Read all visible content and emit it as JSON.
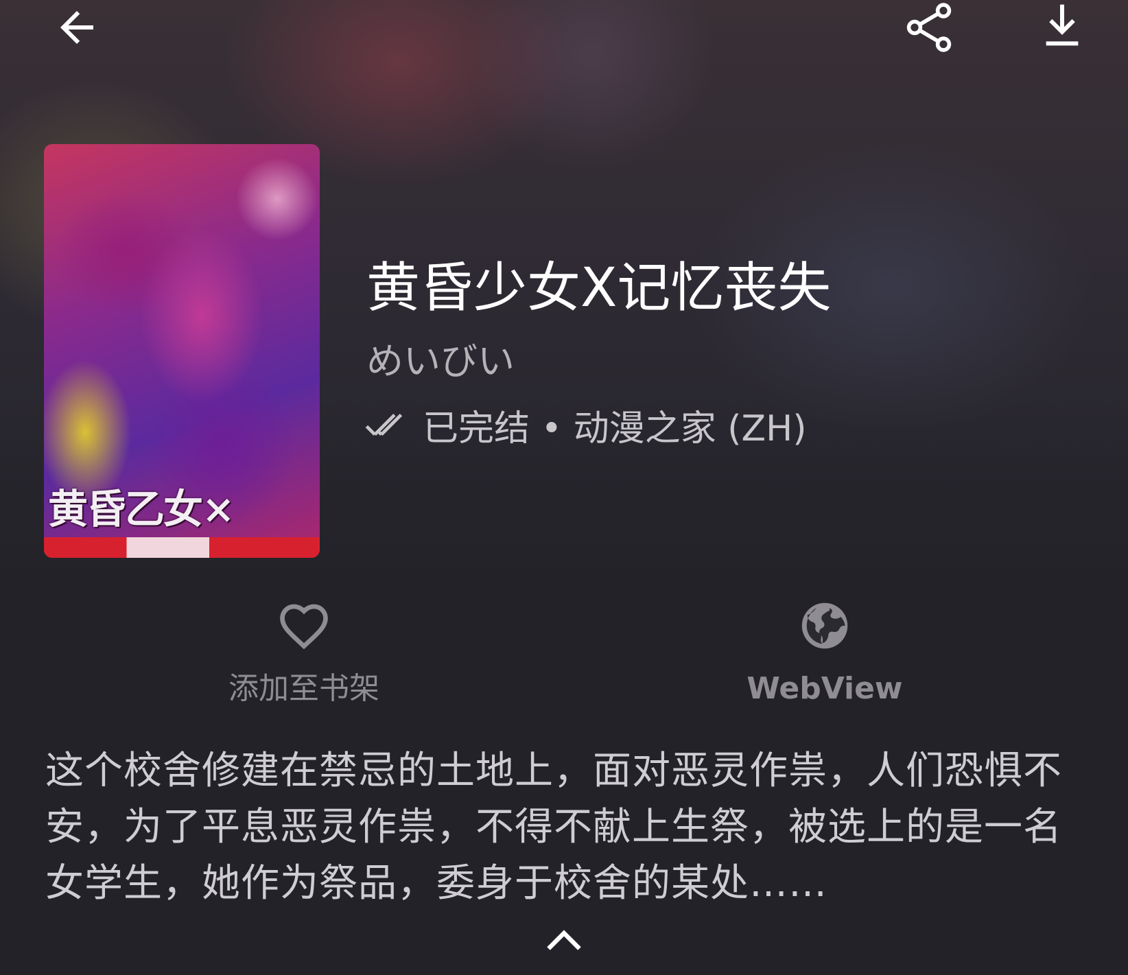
{
  "colors": {
    "background": "#222228",
    "title": "#ffffff",
    "secondary_text": "#b5b3b8",
    "action_grey": "#8f8d93",
    "description_text": "#cfcdd2"
  },
  "topbar": {
    "back_icon": "arrow-back-icon",
    "share_icon": "share-icon",
    "download_icon": "download-icon"
  },
  "cover": {
    "art_title": "黄昏乙女×"
  },
  "manga": {
    "title": "黄昏少女X记忆丧失",
    "author": "めいびい",
    "status_icon": "done-all-icon",
    "status_text": "已完结 • 动漫之家 (ZH)"
  },
  "actions": {
    "favorite": {
      "icon": "heart-outline-icon",
      "label": "添加至书架"
    },
    "webview": {
      "icon": "globe-icon",
      "label": "WebView"
    }
  },
  "description": "这个校舍修建在禁忌的土地上，面对恶灵作祟，人们恐惧不安，为了平息恶灵作祟，不得不献上生祭，被选上的是一名女学生，她作为祭品，委身于校舍的某处……",
  "expand": {
    "icon": "chevron-up-icon"
  }
}
